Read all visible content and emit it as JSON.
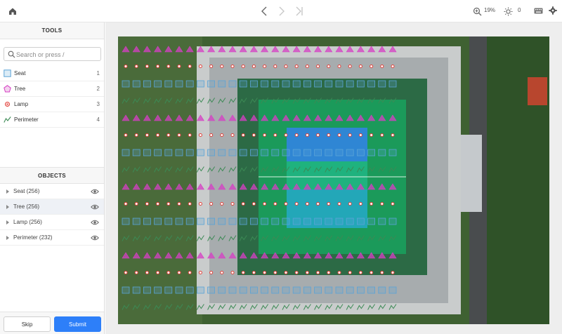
{
  "toolbar": {
    "zoom_value": "19%",
    "brightness_value": "0",
    "icons": [
      "home-icon",
      "chevron-left-icon",
      "chevron-right-icon",
      "skip-to-end-icon",
      "zoom-in-icon",
      "brightness-icon",
      "keyboard-icon",
      "gear-icon"
    ]
  },
  "sidebar": {
    "tools_title": "TOOLS",
    "search_placeholder": "Search or press /",
    "tools": [
      {
        "label": "Seat",
        "count": "1",
        "shape": "square",
        "color": "#5aa3d6"
      },
      {
        "label": "Tree",
        "count": "2",
        "shape": "pentagon",
        "color": "#d63fc4"
      },
      {
        "label": "Lamp",
        "count": "3",
        "shape": "point",
        "color": "#e2413b"
      },
      {
        "label": "Perimeter",
        "count": "4",
        "shape": "polyline",
        "color": "#3c8a55"
      }
    ],
    "objects_title": "OBJECTS",
    "objects": [
      {
        "label": "Seat (256)"
      },
      {
        "label": "Tree (256)"
      },
      {
        "label": "Lamp (256)"
      },
      {
        "label": "Perimeter (232)"
      }
    ],
    "skip_label": "Skip",
    "submit_label": "Submit"
  },
  "colors": {
    "accent": "#2d7ff9",
    "seat": "#5aa3d6",
    "tree": "#d63fc4",
    "lamp": "#e2413b",
    "perimeter": "#3c8a55"
  }
}
